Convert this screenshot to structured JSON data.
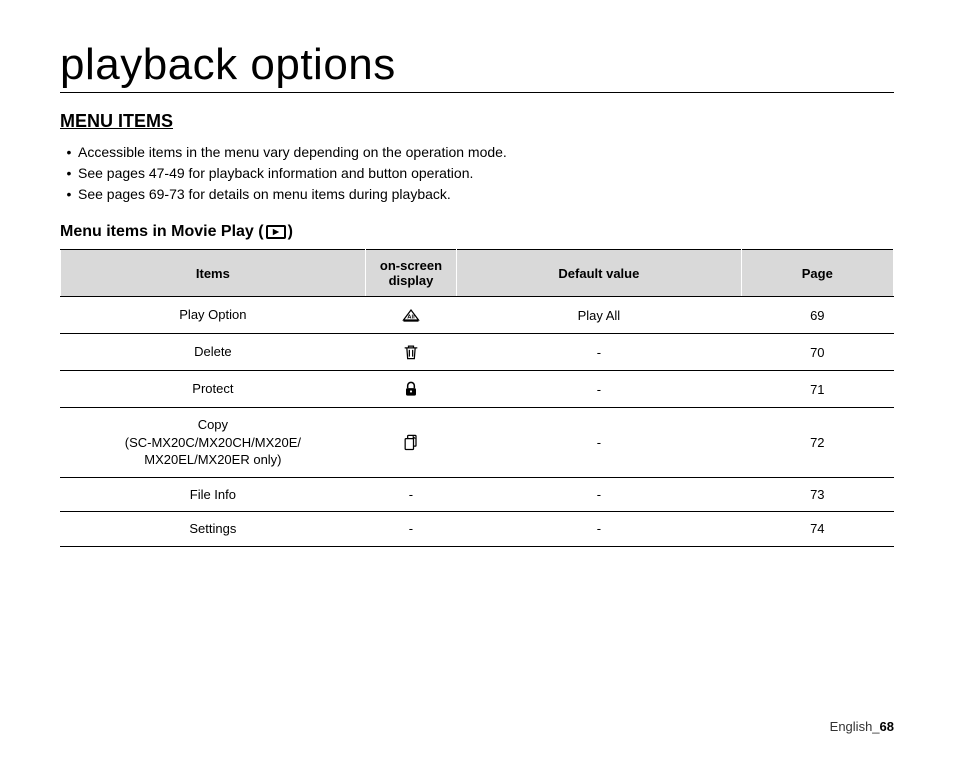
{
  "page_title": "playback options",
  "section_heading": "MENU ITEMS",
  "bullets": [
    "Accessible items in the menu vary depending on the operation mode.",
    "See pages 47-49 for playback information and button operation.",
    "See pages 69-73 for details on menu items during playback."
  ],
  "subheading_prefix": "Menu items in Movie Play (",
  "subheading_suffix": ")",
  "table": {
    "headers": {
      "items": "Items",
      "osd": "on-screen display",
      "default": "Default value",
      "page": "Page"
    },
    "rows": [
      {
        "item": "Play Option",
        "icon": "play-all",
        "default": "Play All",
        "page": "69"
      },
      {
        "item": "Delete",
        "icon": "trash",
        "default": "-",
        "page": "70"
      },
      {
        "item": "Protect",
        "icon": "lock",
        "default": "-",
        "page": "71"
      },
      {
        "item": "Copy\n(SC-MX20C/MX20CH/MX20E/\nMX20EL/MX20ER only)",
        "icon": "copy",
        "default": "-",
        "page": "72"
      },
      {
        "item": "File Info",
        "icon": "-",
        "default": "-",
        "page": "73"
      },
      {
        "item": "Settings",
        "icon": "-",
        "default": "-",
        "page": "74"
      }
    ]
  },
  "footer_label": "English_",
  "footer_page": "68"
}
